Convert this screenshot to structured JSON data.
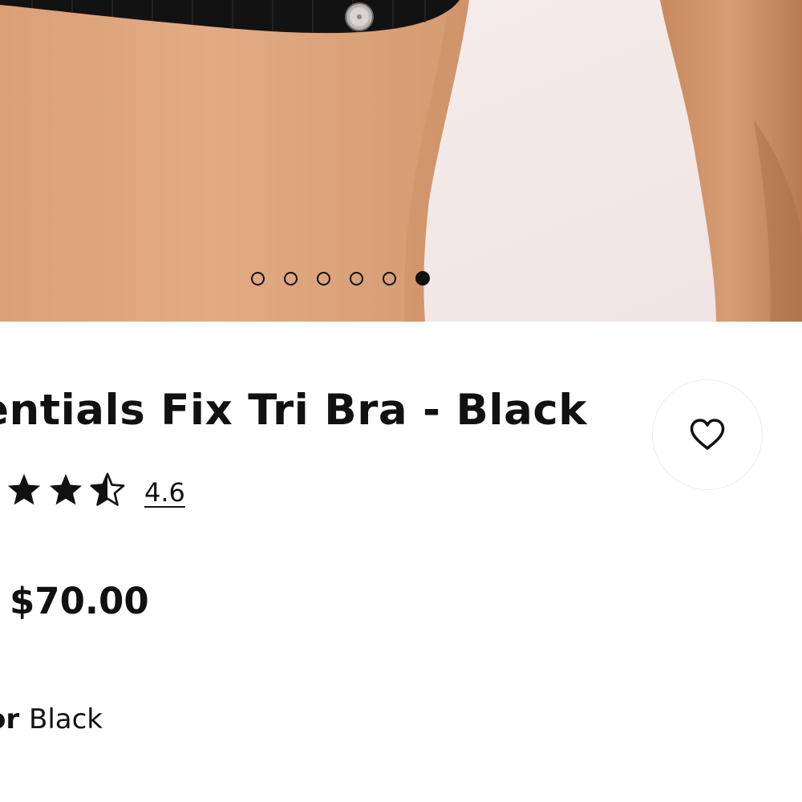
{
  "gallery": {
    "image_alt": "Essentials Fix Tri Bra - Black product photo",
    "slide_count": 6,
    "active_slide": 6
  },
  "product": {
    "title": "Essentials Fix Tri Bra - Black",
    "rating_value": "4.6",
    "rating_fraction": 0.92,
    "price": "$70.00",
    "color_label": "Color",
    "color_value": "Black"
  },
  "wishlist": {
    "icon": "heart-icon",
    "label": "Add to wishlist"
  },
  "colors": {
    "text": "#111111",
    "skin": "#dca47c",
    "background_photo": "#f3eae9",
    "fabric": "#121212"
  }
}
